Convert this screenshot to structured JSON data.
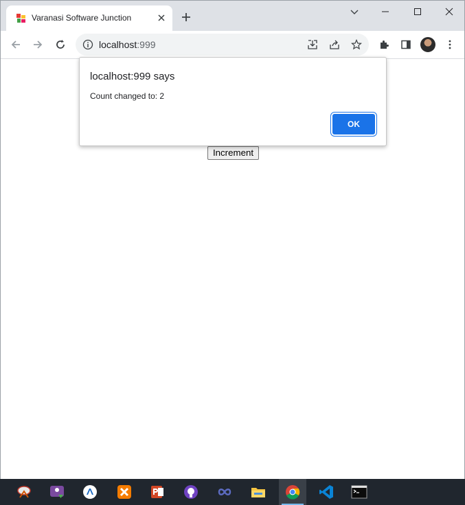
{
  "browser": {
    "tab": {
      "title": "Varanasi Software Junction",
      "favicon": "colorful-squares-icon"
    },
    "url": {
      "host": "localhost",
      "port": ":999"
    },
    "window_controls": [
      "minimize-icon",
      "maximize-icon",
      "close-icon"
    ]
  },
  "page": {
    "increment_label": "Increment"
  },
  "dialog": {
    "title": "localhost:999 says",
    "message": "Count changed to: 2",
    "ok_label": "OK"
  },
  "taskbar": {
    "items": [
      {
        "name": "snipping-tool-icon"
      },
      {
        "name": "teams-icon"
      },
      {
        "name": "edge-dev-icon"
      },
      {
        "name": "xampp-icon"
      },
      {
        "name": "powerpoint-icon"
      },
      {
        "name": "github-icon"
      },
      {
        "name": "infinity-app-icon"
      },
      {
        "name": "file-explorer-icon"
      },
      {
        "name": "chrome-icon",
        "active": true
      },
      {
        "name": "vscode-icon"
      },
      {
        "name": "terminal-icon"
      }
    ]
  },
  "colors": {
    "accent": "#1a73e8",
    "tabstrip": "#dee1e6",
    "taskbar": "#20262e"
  }
}
